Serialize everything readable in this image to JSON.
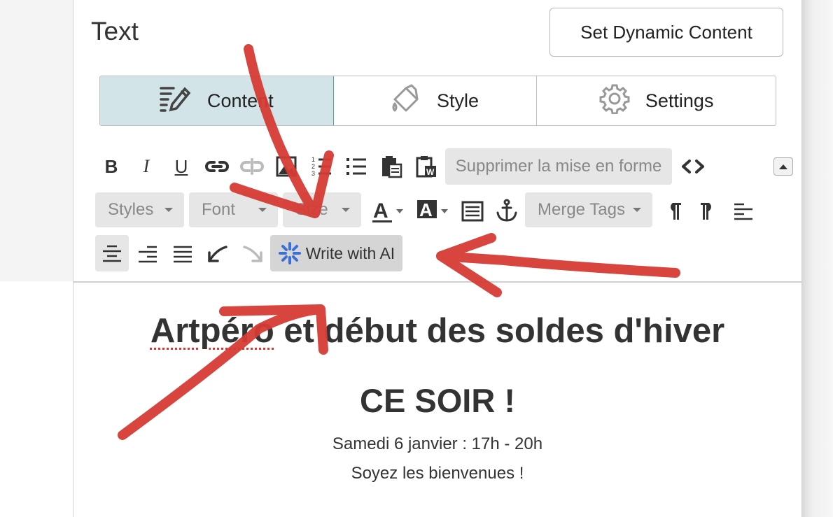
{
  "panel": {
    "title": "Text",
    "dynamic_button": "Set Dynamic Content"
  },
  "tabs": [
    {
      "label": "Content",
      "icon": "edit-lines-icon",
      "active": true
    },
    {
      "label": "Style",
      "icon": "paint-bucket-icon",
      "active": false
    },
    {
      "label": "Settings",
      "icon": "gear-icon",
      "active": false
    }
  ],
  "toolbar": {
    "bold": "B",
    "italic": "I",
    "underline": "U",
    "remove_format": "Supprimer la mise en forme",
    "styles": "Styles",
    "font": "Font",
    "size": "Size",
    "merge_tags": "Merge Tags",
    "write_ai": "Write with AI"
  },
  "content": {
    "heading_spell": "Artpéro",
    "heading_rest": " et début des soldes d'hiver",
    "subheading": "CE SOIR !",
    "line1": "Samedi 6 janvier : 17h - 20h",
    "line2": "Soyez les bienvenues !"
  },
  "colors": {
    "active_tab_bg": "#d3e4e8",
    "active_tab_border": "#5b9aa6",
    "annotation_red": "#d63b34",
    "ai_sparkle": "#3b6fd8"
  }
}
